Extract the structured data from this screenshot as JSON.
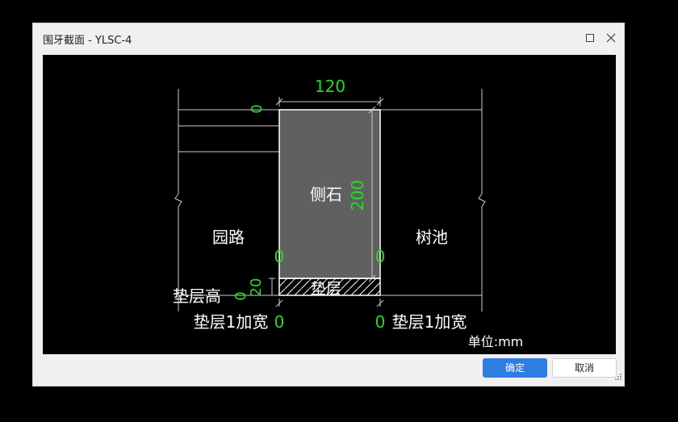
{
  "window": {
    "title": "围牙截面 - YLSC-4"
  },
  "labels": {
    "top_width": "120",
    "top_gap": "0",
    "height": "200",
    "curb_name": "侧石",
    "left_area": "园路",
    "right_area": "树池",
    "left_gap": "0",
    "right_gap": "0",
    "cushion_name": "垫层",
    "cushion_thickness": "20",
    "cushion_height_label": "垫层高",
    "cushion_height_value": "0",
    "left_widen_label": "垫层1加宽",
    "left_widen_value": "0",
    "right_widen_value": "0",
    "right_widen_label": "垫层1加宽",
    "unit": "单位:mm"
  },
  "buttons": {
    "ok": "确定",
    "cancel": "取消"
  },
  "colors": {
    "dimension": "#22dd22",
    "text": "#ffffff",
    "curb_fill": "#606060",
    "accent": "#2f7de1"
  }
}
